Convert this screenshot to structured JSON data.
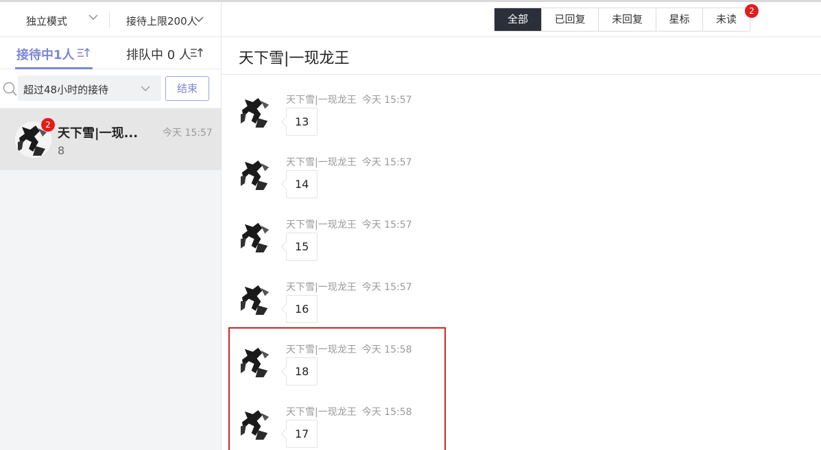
{
  "sidebar": {
    "mode_label": "独立模式",
    "limit_label": "接待上限200人",
    "tabs": [
      {
        "label": "接待中1人"
      },
      {
        "label": "排队中 0 人"
      }
    ],
    "filter": {
      "selected": "超过48小时的接待"
    },
    "end_button": "结束",
    "conversation": {
      "name": "天下雪|一现...",
      "time": "今天 15:57",
      "preview": "8",
      "badge": "2"
    }
  },
  "main": {
    "segments": [
      {
        "label": "全部",
        "active": true
      },
      {
        "label": "已回复",
        "active": false
      },
      {
        "label": "未回复",
        "active": false
      },
      {
        "label": "星标",
        "active": false
      },
      {
        "label": "未读",
        "active": false
      }
    ],
    "unread_badge": "2",
    "chat_title": "天下雪|一现龙王",
    "messages": [
      {
        "sender": "天下雪|一现龙王",
        "time": "今天 15:57",
        "text": "13"
      },
      {
        "sender": "天下雪|一现龙王",
        "time": "今天 15:57",
        "text": "14"
      },
      {
        "sender": "天下雪|一现龙王",
        "time": "今天 15:57",
        "text": "15"
      },
      {
        "sender": "天下雪|一现龙王",
        "time": "今天 15:57",
        "text": "16"
      },
      {
        "sender": "天下雪|一现龙王",
        "time": "今天 15:58",
        "text": "18"
      },
      {
        "sender": "天下雪|一现龙王",
        "time": "今天 15:58",
        "text": "17"
      }
    ]
  },
  "colors": {
    "accent": "#7b86d6",
    "badge": "#e31b1b",
    "segment_active": "#2b2f3a",
    "highlight_box": "#d42020"
  }
}
